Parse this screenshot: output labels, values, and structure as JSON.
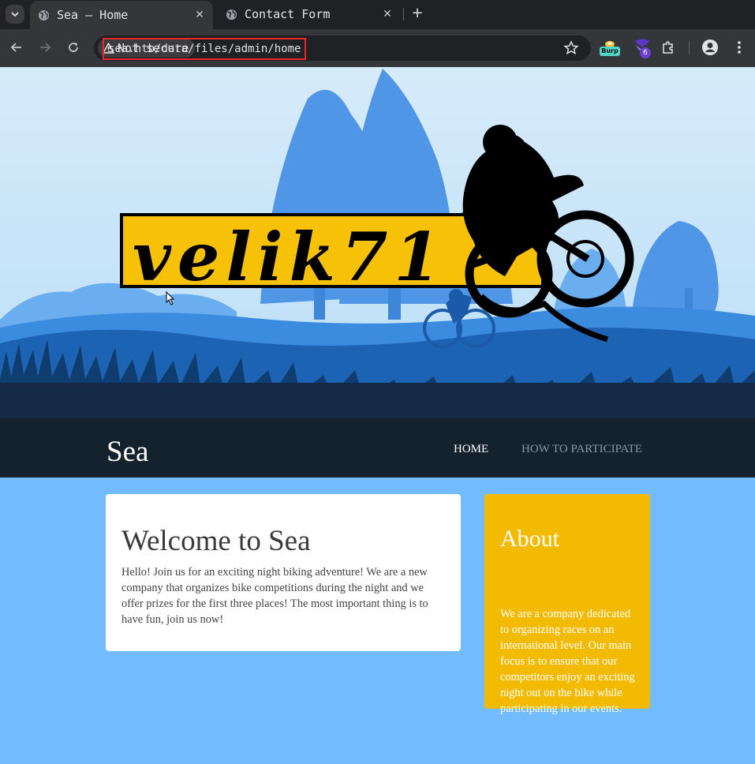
{
  "browser": {
    "tabs": [
      {
        "title": "Sea – Home",
        "active": true
      },
      {
        "title": "Contact Form",
        "active": false
      }
    ],
    "security_label": "Not secure",
    "url": "sea.htb/data/files/admin/home",
    "extensions": [
      {
        "name": "burp-icon",
        "label": "Burp"
      },
      {
        "name": "wappalyzer-icon",
        "badge": "6"
      }
    ]
  },
  "banner": {
    "logo_text": "velik71"
  },
  "site": {
    "title": "Sea",
    "nav": [
      {
        "label": "HOME",
        "active": true
      },
      {
        "label": "HOW TO PARTICIPATE",
        "active": false
      }
    ]
  },
  "welcome": {
    "heading": "Welcome to Sea",
    "body": "Hello! Join us for an exciting night biking adventure! We are a new company that organizes bike competitions during the night and we offer prizes for the first three places! The most important thing is to have fun, join us now!"
  },
  "about": {
    "heading": "About",
    "body": "We are a company dedicated to organizing races on an international level. Our main focus is to ensure that our competitors enjoy an exciting night out on the bike while participating in our events."
  },
  "colors": {
    "hero_sky": "#d6ebfa",
    "header_dark": "#14222e",
    "page_blue": "#72bbfc",
    "about_yellow": "#f2bb02",
    "logo_yellow": "#f7c107"
  }
}
